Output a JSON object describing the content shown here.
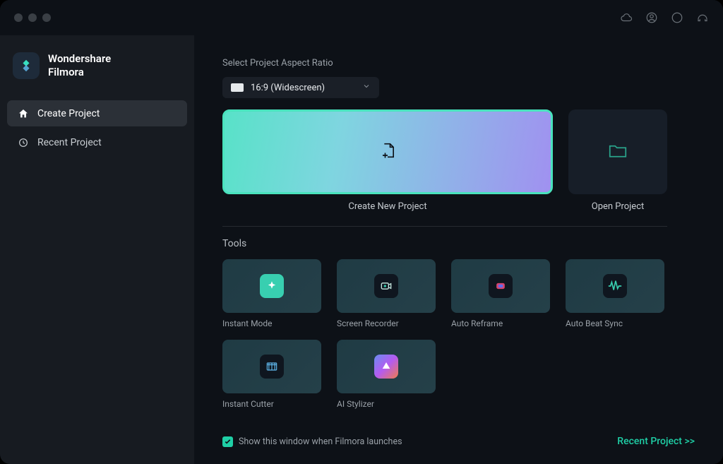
{
  "brand": {
    "line1": "Wondershare",
    "line2": "Filmora"
  },
  "sidebar": {
    "items": [
      {
        "label": "Create Project",
        "active": true
      },
      {
        "label": "Recent Project",
        "active": false
      }
    ]
  },
  "main": {
    "aspect_label": "Select Project Aspect Ratio",
    "aspect_value": "16:9 (Widescreen)",
    "create_label": "Create New Project",
    "open_label": "Open Project",
    "tools_heading": "Tools",
    "tools": [
      {
        "label": "Instant Mode"
      },
      {
        "label": "Screen Recorder"
      },
      {
        "label": "Auto Reframe"
      },
      {
        "label": "Auto Beat Sync"
      },
      {
        "label": "Instant Cutter"
      },
      {
        "label": "AI Stylizer"
      }
    ],
    "checkbox_label": "Show this window when Filmora launches",
    "recent_link": "Recent Project >>"
  }
}
